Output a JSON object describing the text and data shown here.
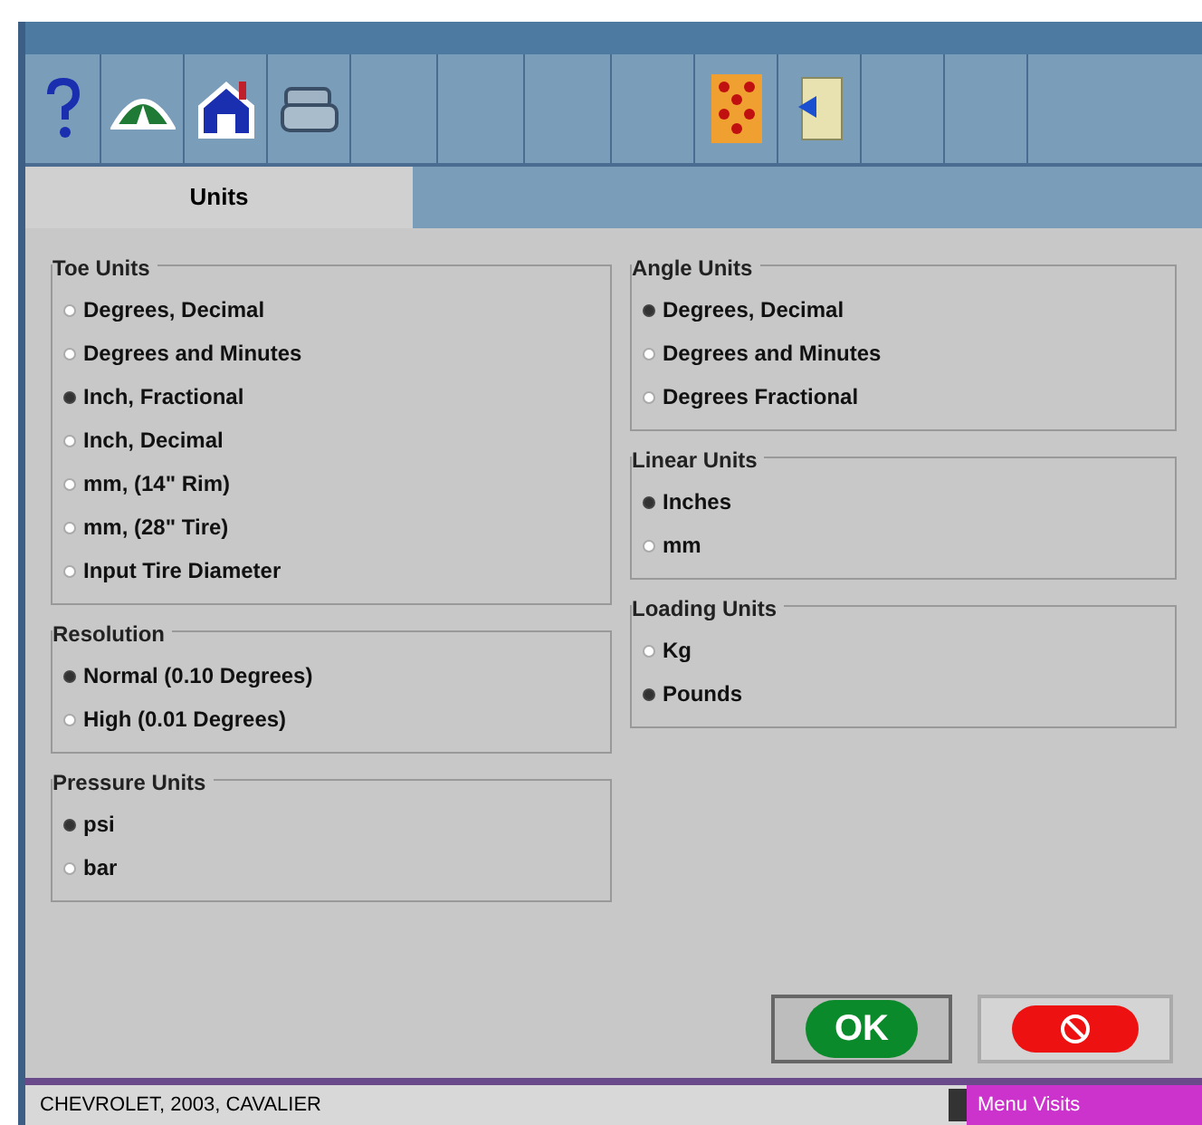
{
  "tabs": [
    {
      "label": "Units",
      "selected": true
    }
  ],
  "left_groups": [
    {
      "title": "Toe Units",
      "options": [
        {
          "label": "Degrees, Decimal",
          "selected": false
        },
        {
          "label": "Degrees and Minutes",
          "selected": false
        },
        {
          "label": "Inch, Fractional",
          "selected": true
        },
        {
          "label": "Inch, Decimal",
          "selected": false
        },
        {
          "label": "mm, (14\" Rim)",
          "selected": false
        },
        {
          "label": "mm, (28\" Tire)",
          "selected": false
        },
        {
          "label": "Input Tire Diameter",
          "selected": false
        }
      ]
    },
    {
      "title": "Resolution",
      "options": [
        {
          "label": "Normal (0.10 Degrees)",
          "selected": true
        },
        {
          "label": "High (0.01 Degrees)",
          "selected": false
        }
      ]
    },
    {
      "title": "Pressure Units",
      "options": [
        {
          "label": "psi",
          "selected": true
        },
        {
          "label": "bar",
          "selected": false
        }
      ]
    }
  ],
  "right_groups": [
    {
      "title": "Angle Units",
      "options": [
        {
          "label": "Degrees, Decimal",
          "selected": true
        },
        {
          "label": "Degrees and Minutes",
          "selected": false
        },
        {
          "label": "Degrees Fractional",
          "selected": false
        }
      ]
    },
    {
      "title": "Linear Units",
      "options": [
        {
          "label": "Inches",
          "selected": true
        },
        {
          "label": "mm",
          "selected": false
        }
      ]
    },
    {
      "title": "Loading Units",
      "options": [
        {
          "label": "Kg",
          "selected": false
        },
        {
          "label": "Pounds",
          "selected": true
        }
      ]
    }
  ],
  "ok_button": {
    "label": "OK"
  },
  "status_bar": {
    "vehicle": "CHEVROLET, 2003, CAVALIER",
    "mode": "Menu Visits"
  }
}
